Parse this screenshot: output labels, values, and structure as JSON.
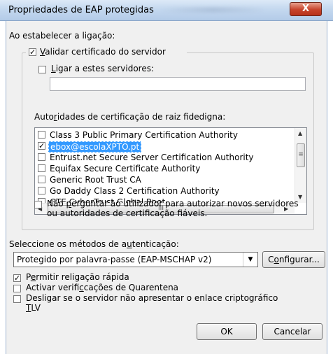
{
  "window": {
    "title": "Propriedades de EAP protegidas",
    "close_glyph": "X"
  },
  "connection": {
    "heading": "Ao estabelecer a ligação:",
    "validate_cert": {
      "label": "Validar certificado do servidor",
      "checked": true,
      "check_glyph": "✓"
    },
    "connect_servers": {
      "label": "Ligar a estes servidores:",
      "checked": false
    },
    "servers_value": "",
    "root_ca_heading": "Autoridades de certificação de raiz fidedigna:",
    "ca_list": [
      {
        "label": "Class 3 Public Primary Certification Authority",
        "checked": false
      },
      {
        "label": "ebox@escolaXPTO.pt",
        "checked": true,
        "selected": true
      },
      {
        "label": "Entrust.net Secure Server Certification Authority",
        "checked": false
      },
      {
        "label": "Equifax Secure Certificate Authority",
        "checked": false
      },
      {
        "label": "Generic Root Trust CA",
        "checked": false
      },
      {
        "label": "Go Daddy Class 2 Certification Authority",
        "checked": false
      },
      {
        "label": "GTE CyberTrust Global Root",
        "checked": false
      }
    ],
    "scroll_up": "▲",
    "scroll_down": "▼",
    "scroll_left": "◀",
    "scroll_right": "▶",
    "grip_v": "≡",
    "grip_h": "III",
    "no_prompt": {
      "line1": "Não perguntar ao utilizador para autorizar novos servidores",
      "line2": "ou autoridades de certificação fiáveis.",
      "checked": false
    }
  },
  "auth": {
    "heading": "Seleccione os métodos de autenticação:",
    "method_value": "Protegido por palavra-passe (EAP-MSCHAP v2)",
    "dropdown_glyph": "▼",
    "configure_label": "Configurar..."
  },
  "options": {
    "fast_reconnect": {
      "label": "Permitir religação rápida",
      "checked": true
    },
    "quarantine": {
      "label": "Activar verificações de Quarentena",
      "checked": false
    },
    "disconnect_tlv": {
      "line1": "Desligar se o servidor não apresentar o enlace criptográfico",
      "line2": "TLV",
      "checked": false
    }
  },
  "buttons": {
    "ok": "OK",
    "cancel": "Cancelar"
  }
}
